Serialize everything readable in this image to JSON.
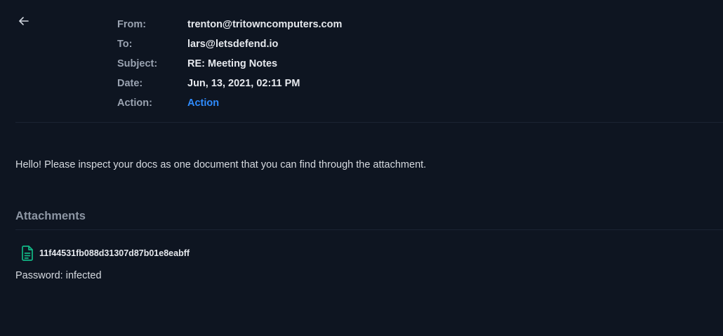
{
  "header": {
    "back_icon": "arrow-left-icon",
    "from_label": "From:",
    "from_value": "trenton@tritowncomputers.com",
    "to_label": "To:",
    "to_value": "lars@letsdefend.io",
    "subject_label": "Subject:",
    "subject_value": "RE: Meeting Notes",
    "date_label": "Date:",
    "date_value": "Jun, 13, 2021, 02:11 PM",
    "action_label": "Action:",
    "action_value": "Action"
  },
  "body": {
    "text": "Hello! Please inspect your docs as one document that you can find through the attachment."
  },
  "attachments": {
    "title": "Attachments",
    "items": [
      {
        "icon": "file-document-icon",
        "name": "11f44531fb088d31307d87b01e8eabff"
      }
    ],
    "password_text": "Password: infected"
  },
  "colors": {
    "background": "#0e1521",
    "label": "#9aa3b1",
    "value": "#e6e9ee",
    "link": "#2f8cff",
    "file_icon": "#12b886"
  }
}
